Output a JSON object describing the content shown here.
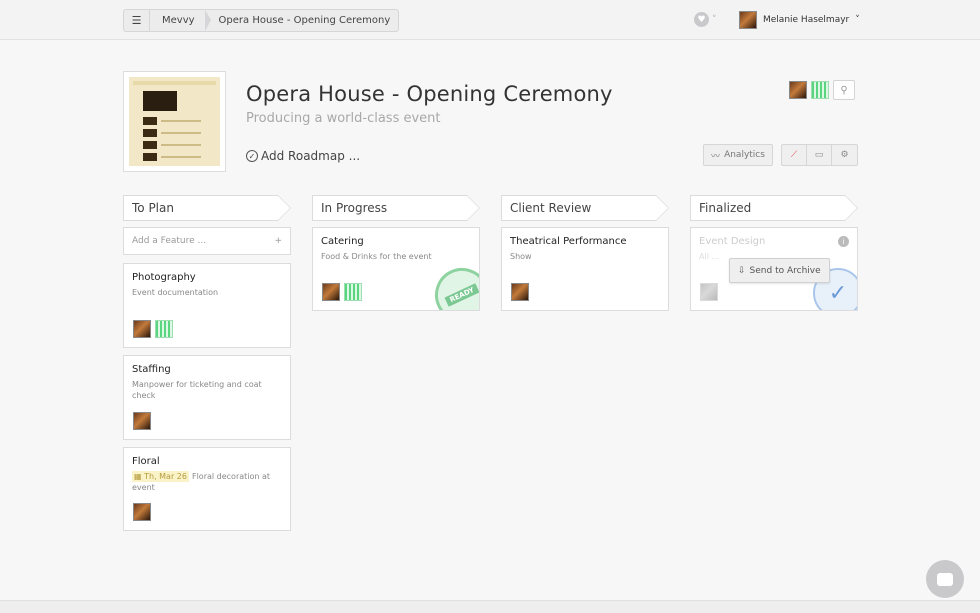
{
  "header": {
    "menu_icon": "hamburger-icon",
    "breadcrumb": [
      "Mevvy",
      "Opera House - Opening Ceremony"
    ],
    "user_name": "Melanie Haselmayr",
    "user_caret": "˅",
    "heart_caret": "˅"
  },
  "project": {
    "title": "Opera House - Opening Ceremony",
    "subtitle": "Producing a world-class event",
    "roadmap_label": "Add Roadmap ..."
  },
  "toolbar": {
    "analytics_label": "Analytics"
  },
  "columns": [
    {
      "title": "To Plan"
    },
    {
      "title": "In Progress"
    },
    {
      "title": "Client Review"
    },
    {
      "title": "Finalized"
    }
  ],
  "add_feature": {
    "placeholder": "Add a Feature ...",
    "plus": "+"
  },
  "cards": {
    "photography": {
      "title": "Photography",
      "desc": "Event documentation"
    },
    "staffing": {
      "title": "Staffing",
      "desc": "Manpower for ticketing and coat check"
    },
    "floral": {
      "title": "Floral",
      "date": "Th, Mar 26",
      "desc": "Floral decoration at event"
    },
    "catering": {
      "title": "Catering",
      "desc": "Food & Drinks for the event",
      "stamp": "READY"
    },
    "theatrical": {
      "title": "Theatrical Performance",
      "desc": "Show"
    },
    "event_design": {
      "title": "Event Design",
      "desc": "All ..."
    }
  },
  "archive": {
    "label": "Send to Archive"
  },
  "colors": {
    "accent_green": "#3fcf6a",
    "done_blue": "#6d9bd8",
    "date_bg": "#fbf3c8"
  }
}
